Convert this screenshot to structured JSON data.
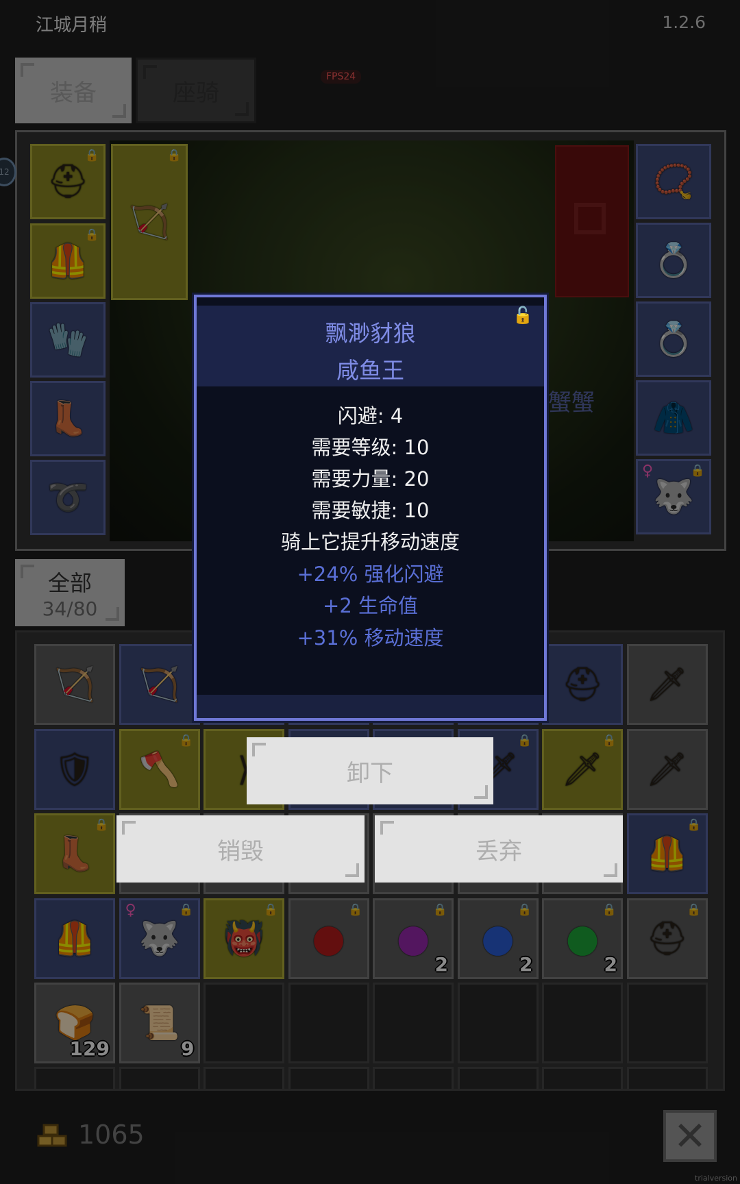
{
  "app": {
    "title": "江城月稍",
    "version": "1.2.6",
    "fps": "FPS24"
  },
  "tabs": [
    {
      "label": "装备",
      "active": true
    },
    {
      "label": "座骑",
      "active": false
    }
  ],
  "side_badge": "12",
  "npc_name": "蟹蟹",
  "equip_left": [
    {
      "icon": "helmet-icon",
      "glyph": "⛑",
      "locked": true,
      "rarity": "yellow"
    },
    {
      "icon": "bow-icon",
      "glyph": "🏹",
      "locked": true,
      "rarity": "yellow"
    },
    {
      "icon": "armor-icon",
      "glyph": "🦺",
      "locked": true,
      "rarity": "yellow"
    },
    {
      "icon": "gloves-icon",
      "glyph": "🧤",
      "locked": false,
      "rarity": "blue"
    },
    {
      "icon": "boots-icon",
      "glyph": "👢",
      "locked": false,
      "rarity": "blue"
    },
    {
      "icon": "belt-icon",
      "glyph": "➰",
      "locked": false,
      "rarity": "blue"
    }
  ],
  "equip_right": [
    {
      "icon": "amulet-icon",
      "glyph": "📿",
      "locked": false,
      "rarity": "blue"
    },
    {
      "icon": "ring-icon",
      "glyph": "💍",
      "locked": false,
      "rarity": "blue"
    },
    {
      "icon": "ring-icon",
      "glyph": "💍",
      "locked": false,
      "rarity": "blue"
    },
    {
      "icon": "cloak-icon",
      "glyph": "🧥",
      "locked": false,
      "rarity": "blue"
    },
    {
      "icon": "mount-portrait-icon",
      "glyph": "🐺",
      "locked": true,
      "female": true,
      "rarity": "blue"
    }
  ],
  "filter": {
    "label": "全部",
    "count": "34/80"
  },
  "inventory": [
    {
      "icon": "bow-icon",
      "glyph": "🏹",
      "rarity": "gray",
      "locked": false,
      "qty": ""
    },
    {
      "icon": "bow-icon",
      "glyph": "🏹",
      "rarity": "blue",
      "locked": false,
      "qty": ""
    },
    {
      "icon": "hidden-item",
      "glyph": "",
      "rarity": "blue",
      "locked": false,
      "qty": ""
    },
    {
      "icon": "hidden-item",
      "glyph": "",
      "rarity": "blue",
      "locked": false,
      "qty": ""
    },
    {
      "icon": "hidden-item",
      "glyph": "",
      "rarity": "blue",
      "locked": false,
      "qty": ""
    },
    {
      "icon": "hidden-item",
      "glyph": "",
      "rarity": "blue",
      "locked": false,
      "qty": ""
    },
    {
      "icon": "helmet-icon",
      "glyph": "⛑",
      "rarity": "blue",
      "locked": false,
      "qty": ""
    },
    {
      "icon": "sword-icon",
      "glyph": "🗡",
      "rarity": "gray",
      "locked": false,
      "qty": ""
    },
    {
      "icon": "shield-icon",
      "glyph": "🛡",
      "rarity": "blue",
      "locked": false,
      "qty": ""
    },
    {
      "icon": "axe-icon",
      "glyph": "🪓",
      "rarity": "yellow",
      "locked": true,
      "qty": ""
    },
    {
      "icon": "boomerang-icon",
      "glyph": "⟩",
      "rarity": "yellow",
      "locked": false,
      "qty": ""
    },
    {
      "icon": "hidden-item",
      "glyph": "",
      "rarity": "blue",
      "locked": false,
      "qty": ""
    },
    {
      "icon": "hidden-item",
      "glyph": "",
      "rarity": "blue",
      "locked": false,
      "qty": ""
    },
    {
      "icon": "sword-icon",
      "glyph": "🗡",
      "rarity": "blue",
      "locked": true,
      "qty": ""
    },
    {
      "icon": "sword-icon",
      "glyph": "🗡",
      "rarity": "yellow",
      "locked": true,
      "qty": ""
    },
    {
      "icon": "sword-icon",
      "glyph": "🗡",
      "rarity": "gray",
      "locked": false,
      "qty": ""
    },
    {
      "icon": "boots-icon",
      "glyph": "👢",
      "rarity": "yellow",
      "locked": true,
      "qty": ""
    },
    {
      "icon": "hidden-item",
      "glyph": "",
      "rarity": "gray",
      "locked": false,
      "qty": ""
    },
    {
      "icon": "hidden-item",
      "glyph": "",
      "rarity": "gray",
      "locked": false,
      "qty": ""
    },
    {
      "icon": "hidden-item",
      "glyph": "",
      "rarity": "gray",
      "locked": false,
      "qty": ""
    },
    {
      "icon": "hidden-item",
      "glyph": "",
      "rarity": "gray",
      "locked": false,
      "qty": ""
    },
    {
      "icon": "hidden-item",
      "glyph": "",
      "rarity": "gray",
      "locked": false,
      "qty": ""
    },
    {
      "icon": "hidden-item",
      "glyph": "",
      "rarity": "gray",
      "locked": false,
      "qty": ""
    },
    {
      "icon": "armor-icon",
      "glyph": "🦺",
      "rarity": "blue",
      "locked": true,
      "qty": ""
    },
    {
      "icon": "armor-icon",
      "glyph": "🦺",
      "rarity": "blue",
      "locked": false,
      "qty": ""
    },
    {
      "icon": "mount-portrait-icon",
      "glyph": "🐺",
      "rarity": "blue",
      "locked": true,
      "female": true,
      "qty": ""
    },
    {
      "icon": "horned-helmet-icon",
      "glyph": "👹",
      "rarity": "yellow",
      "locked": true,
      "qty": ""
    },
    {
      "icon": "red-gem-icon",
      "glyph": "●",
      "color": "#b81c1c",
      "rarity": "gray",
      "locked": true,
      "qty": ""
    },
    {
      "icon": "purple-gem-icon",
      "glyph": "●",
      "color": "#9a2ab0",
      "rarity": "gray",
      "locked": true,
      "qty": "2"
    },
    {
      "icon": "blue-gem-icon",
      "glyph": "●",
      "color": "#2b5fd9",
      "rarity": "gray",
      "locked": true,
      "qty": "2"
    },
    {
      "icon": "green-gem-icon",
      "glyph": "●",
      "color": "#1fa83a",
      "rarity": "gray",
      "locked": true,
      "qty": "2"
    },
    {
      "icon": "helmet-icon",
      "glyph": "⛑",
      "rarity": "gray",
      "locked": true,
      "qty": ""
    },
    {
      "icon": "bread-icon",
      "glyph": "🍞",
      "rarity": "gray",
      "locked": false,
      "qty": "129"
    },
    {
      "icon": "scroll-icon",
      "glyph": "📜",
      "rarity": "gray",
      "locked": false,
      "qty": "9"
    },
    {
      "icon": "empty-slot",
      "glyph": "",
      "rarity": "empty",
      "locked": false,
      "qty": ""
    },
    {
      "icon": "empty-slot",
      "glyph": "",
      "rarity": "empty",
      "locked": false,
      "qty": ""
    },
    {
      "icon": "empty-slot",
      "glyph": "",
      "rarity": "empty",
      "locked": false,
      "qty": ""
    },
    {
      "icon": "empty-slot",
      "glyph": "",
      "rarity": "empty",
      "locked": false,
      "qty": ""
    },
    {
      "icon": "empty-slot",
      "glyph": "",
      "rarity": "empty",
      "locked": false,
      "qty": ""
    },
    {
      "icon": "empty-slot",
      "glyph": "",
      "rarity": "empty",
      "locked": false,
      "qty": ""
    }
  ],
  "tooltip": {
    "name": "飘渺豺狼",
    "owner": "咸鱼王",
    "stats": [
      "闪避: 4",
      "需要等级: 10",
      "需要力量: 20",
      "需要敏捷: 10",
      "骑上它提升移动速度"
    ],
    "bonuses": [
      "+24% 强化闪避",
      "+2 生命值",
      "+31% 移动速度"
    ]
  },
  "actions": {
    "unequip": "卸下",
    "destroy": "销毁",
    "discard": "丢弃"
  },
  "footer": {
    "gold": "1065",
    "close_glyph": "✕",
    "watermark": "trialversion"
  },
  "colors": {
    "yellow_slot": "#8c8a23",
    "blue_slot": "#3e4a78",
    "gray_slot": "#5c5c5c",
    "tooltip_border": "#6f78d6",
    "bonus_text": "#5a6fd6",
    "name_text": "#7f8ce6",
    "fps_text": "#ff5a5a"
  }
}
